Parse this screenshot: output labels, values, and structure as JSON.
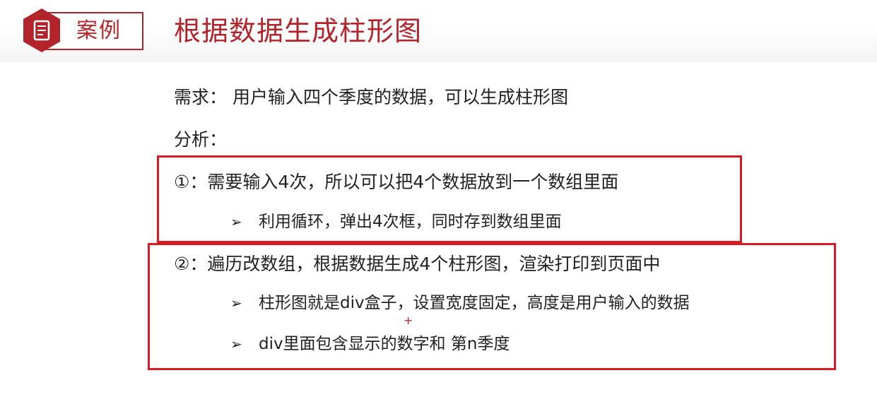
{
  "header": {
    "badge_label": "案例",
    "title": "根据数据生成柱形图"
  },
  "content": {
    "requirement": "需求：  用户输入四个季度的数据，可以生成柱形图",
    "analysis_label": "分析：",
    "step1": {
      "text": "①：需要输入4次，所以可以把4个数据放到一个数组里面",
      "bullets": [
        "利用循环，弹出4次框，同时存到数组里面"
      ]
    },
    "step2": {
      "text": "②：遍历改数组，根据数据生成4个柱形图，渲染打印到页面中",
      "bullets": [
        "柱形图就是div盒子，设置宽度固定，高度是用户输入的数据",
        "div里面包含显示的数字和 第n季度"
      ]
    },
    "bullet_glyph": "➢"
  },
  "colors": {
    "accent": "#b3242a",
    "highlight_border": "#d71a26",
    "text": "#222222"
  },
  "icons": {
    "badge_icon": "document-icon",
    "bullet_icon": "arrowhead-bullet-icon"
  }
}
